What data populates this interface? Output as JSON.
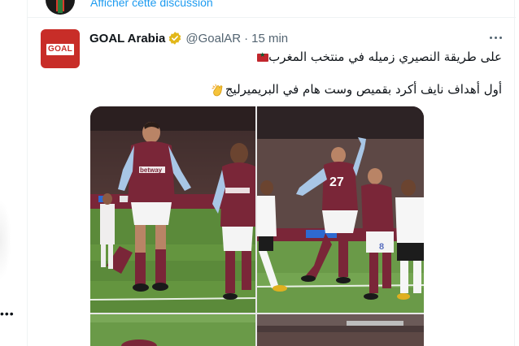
{
  "previous_tweet": {
    "show_thread_label": "Afficher cette discussion"
  },
  "tweet": {
    "author_name": "GOAL Arabia",
    "author_handle": "@GoalAR",
    "separator": "·",
    "timestamp": "15 min",
    "avatar_logo_text": "GOAL",
    "text_line_1": "على طريقة النصيري زميله في منتخب المغرب",
    "text_line_2": "أول أهداف نايف أكرد بقميص وست هام في البريميرليج",
    "flag_icon": "morocco-flag-icon",
    "clap_icon": "clapping-hands-icon",
    "sponsor_text": "betway",
    "shirt_number": "27"
  },
  "left_rail": {
    "more_label": "•••"
  },
  "colors": {
    "link": "#1d9bf0",
    "secondary_text": "#536471",
    "primary_text": "#0f1419",
    "avatar_red": "#c82d28",
    "claret": "#7a2638",
    "pitch_green": "#5b8a3a"
  }
}
